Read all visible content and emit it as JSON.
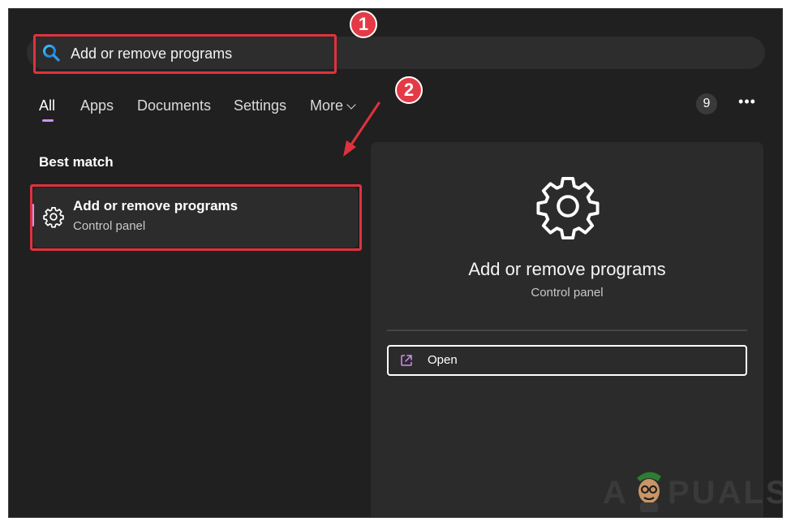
{
  "search": {
    "value": "Add or remove programs"
  },
  "tabs": [
    {
      "label": "All",
      "active": true
    },
    {
      "label": "Apps"
    },
    {
      "label": "Documents"
    },
    {
      "label": "Settings"
    },
    {
      "label": "More"
    }
  ],
  "header_right": {
    "count": "9",
    "more_options": "•••"
  },
  "best_match": {
    "section_title": "Best match",
    "item": {
      "title": "Add or remove programs",
      "subtitle": "Control panel",
      "icon": "gear-icon"
    }
  },
  "details": {
    "title": "Add or remove programs",
    "subtitle": "Control panel",
    "icon": "gear-icon",
    "actions": [
      {
        "label": "Open",
        "icon": "open-external-icon"
      }
    ]
  },
  "annotations": {
    "step1": "1",
    "step2": "2"
  },
  "watermark": {
    "left": "A",
    "right": "PUALS"
  },
  "colors": {
    "accent": "#d78df0",
    "highlight": "#e0323e",
    "background": "#202020"
  }
}
